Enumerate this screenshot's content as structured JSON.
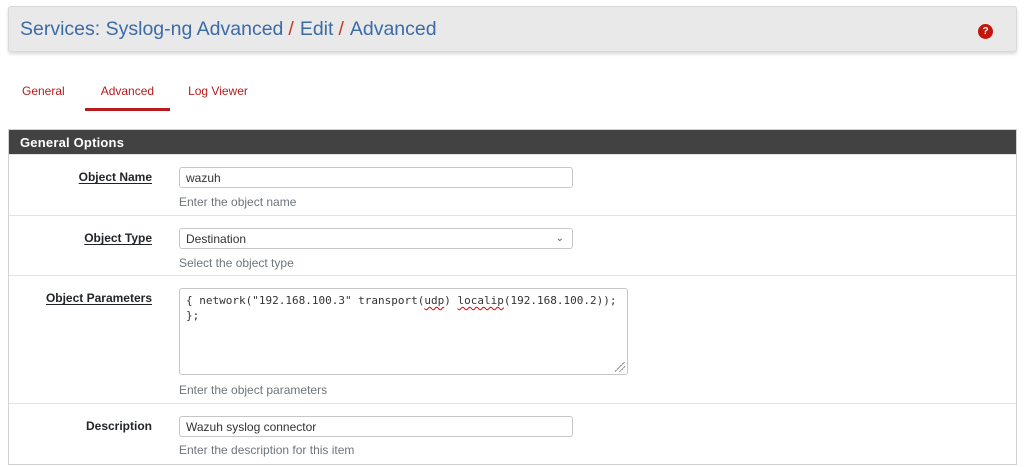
{
  "header": {
    "crumbs": [
      "Services: Syslog-ng Advanced",
      "Edit",
      "Advanced"
    ],
    "separator": "/",
    "help_icon": "question-circle-icon",
    "help_glyph": "?",
    "help_color": "#c4170c"
  },
  "tabs": [
    {
      "label": "General",
      "active": false
    },
    {
      "label": "Advanced",
      "active": true
    },
    {
      "label": "Log Viewer",
      "active": false
    }
  ],
  "panel": {
    "title": "General Options",
    "fields": {
      "object_name": {
        "label": "Object Name",
        "value": "wazuh",
        "help": "Enter the object name"
      },
      "object_type": {
        "label": "Object Type",
        "selected": "Destination",
        "help": "Select the object type"
      },
      "object_parameters": {
        "label": "Object Parameters",
        "line1_a": "{ network(\"192.168.100.3\" transport(",
        "line1_b": "udp",
        "line1_c": ") ",
        "line1_d": "localip",
        "line1_e": "(192.168.100.2));",
        "line2": "};",
        "help": "Enter the object parameters"
      },
      "description": {
        "label": "Description",
        "value": "Wazuh syslog connector",
        "help": "Enter the description for this item"
      }
    }
  },
  "colors": {
    "accent_red": "#b71c1c",
    "link_blue": "#3c6ba6",
    "panel_heading": "#424242"
  }
}
